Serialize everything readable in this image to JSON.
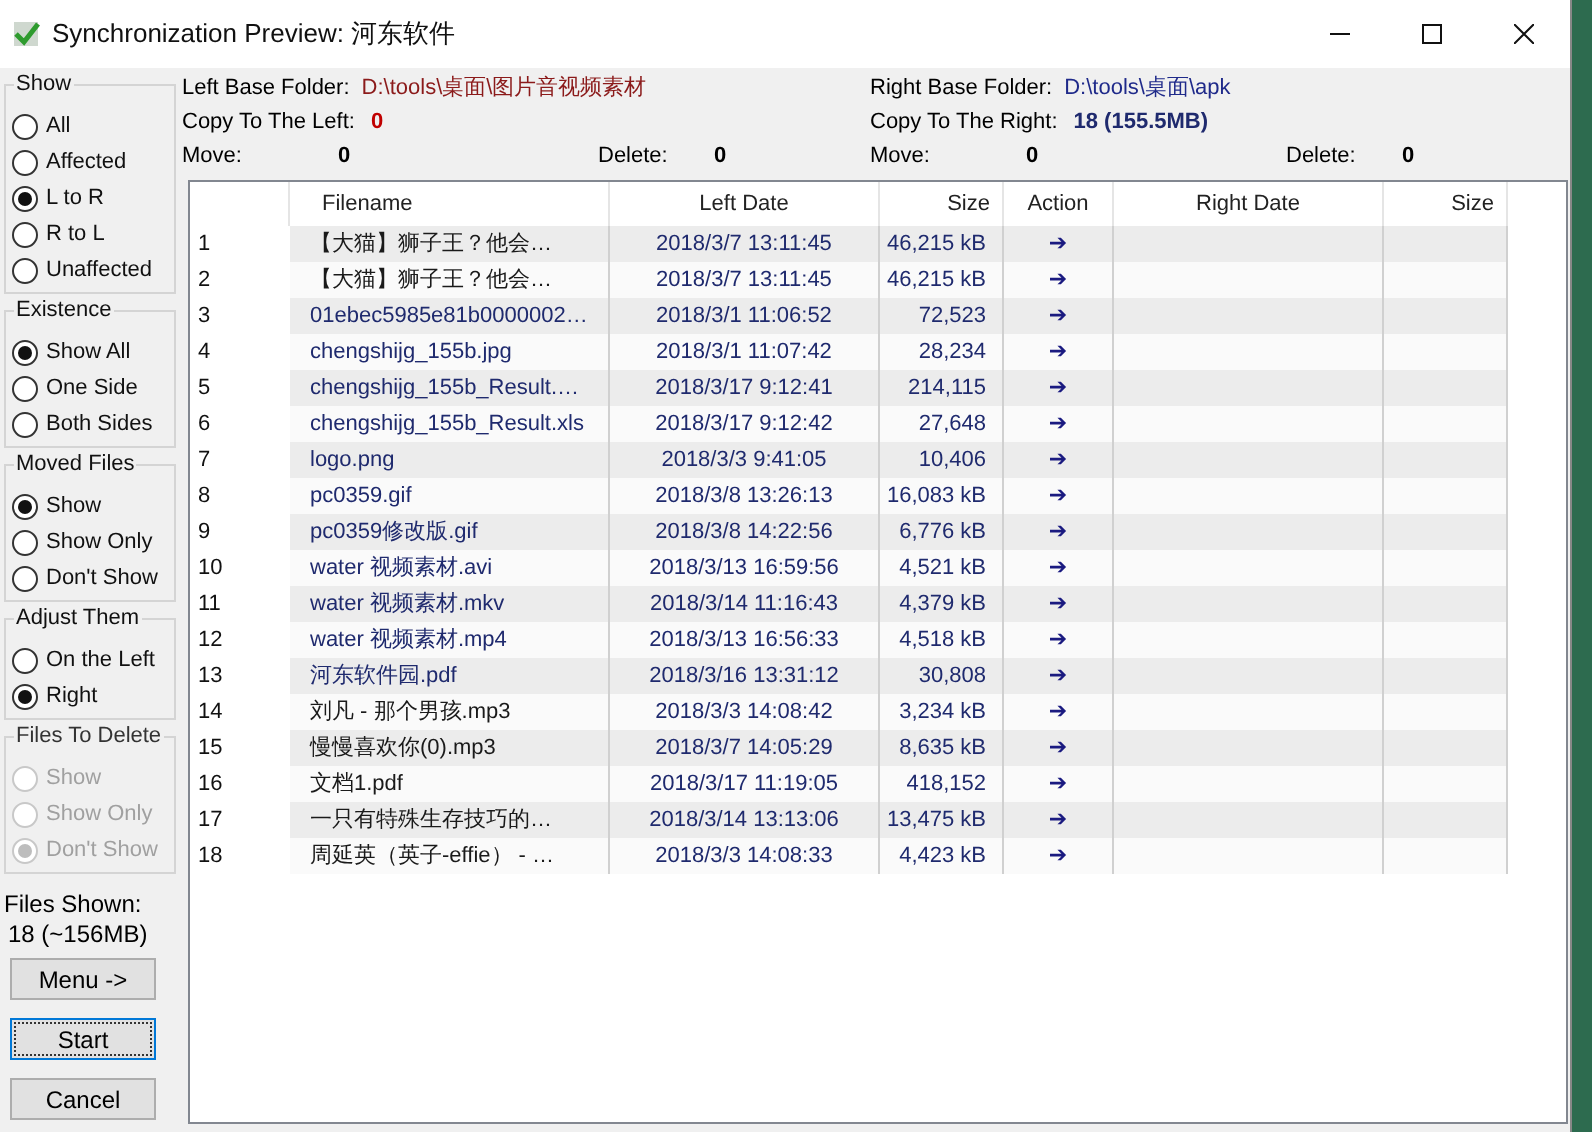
{
  "window": {
    "title": "Synchronization Preview: 河东软件"
  },
  "info": {
    "left": {
      "folder_label": "Left Base Folder:",
      "folder": "D:\\tools\\桌面\\图片音视频素材",
      "copy_label": "Copy To The Left:",
      "copy": "0",
      "move_label": "Move:",
      "move": "0",
      "delete_label": "Delete:",
      "delete": "0"
    },
    "right": {
      "folder_label": "Right Base Folder:",
      "folder": "D:\\tools\\桌面\\apk",
      "copy_label": "Copy To The Right:",
      "copy": "18 (155.5MB)",
      "move_label": "Move:",
      "move": "0",
      "delete_label": "Delete:",
      "delete": "0"
    }
  },
  "filters": [
    {
      "title": "Show",
      "disabled": false,
      "options": [
        {
          "label": "All",
          "selected": false
        },
        {
          "label": "Affected",
          "selected": false
        },
        {
          "label": "L to R",
          "selected": true
        },
        {
          "label": "R to L",
          "selected": false
        },
        {
          "label": "Unaffected",
          "selected": false
        }
      ]
    },
    {
      "title": "Existence",
      "disabled": false,
      "options": [
        {
          "label": "Show All",
          "selected": true
        },
        {
          "label": "One Side",
          "selected": false
        },
        {
          "label": "Both Sides",
          "selected": false
        }
      ]
    },
    {
      "title": "Moved Files",
      "disabled": false,
      "options": [
        {
          "label": "Show",
          "selected": true
        },
        {
          "label": "Show Only",
          "selected": false
        },
        {
          "label": "Don't Show",
          "selected": false
        }
      ]
    },
    {
      "title": "Adjust Them",
      "disabled": false,
      "options": [
        {
          "label": "On the Left",
          "selected": false
        },
        {
          "label": "Right",
          "selected": true
        }
      ]
    },
    {
      "title": "Files To Delete",
      "disabled": true,
      "options": [
        {
          "label": "Show",
          "selected": false
        },
        {
          "label": "Show Only",
          "selected": false
        },
        {
          "label": "Don't Show",
          "selected": true
        }
      ]
    }
  ],
  "files_shown": {
    "label": "Files Shown:",
    "value": "18 (~156MB)"
  },
  "buttons": [
    {
      "label": "Menu ->",
      "focused": false
    },
    {
      "label": "Start",
      "focused": true
    },
    {
      "label": "Cancel",
      "focused": false
    }
  ],
  "table": {
    "columns": [
      "Filename",
      "Left Date",
      "Size",
      "Action",
      "Right Date",
      "Size"
    ],
    "rows": [
      {
        "number": "1",
        "filename": "【大猫】狮子王？他会…",
        "color": "#1a1a1a",
        "left_date": "2018/3/7 13:11:45",
        "size": "46,215 kB",
        "action": "➔"
      },
      {
        "number": "2",
        "filename": "【大猫】狮子王？他会…",
        "color": "#1a1a1a",
        "left_date": "2018/3/7 13:11:45",
        "size": "46,215 kB",
        "action": "➔"
      },
      {
        "number": "3",
        "filename": "01ebec5985e81b0000002…",
        "color": "#1f2a6e",
        "left_date": "2018/3/1 11:06:52",
        "size": "72,523",
        "action": "➔"
      },
      {
        "number": "4",
        "filename": "chengshijg_155b.jpg",
        "color": "#1f2a6e",
        "left_date": "2018/3/1 11:07:42",
        "size": "28,234",
        "action": "➔"
      },
      {
        "number": "5",
        "filename": "chengshijg_155b_Result.…",
        "color": "#1f2a6e",
        "left_date": "2018/3/17 9:12:41",
        "size": "214,115",
        "action": "➔"
      },
      {
        "number": "6",
        "filename": "chengshijg_155b_Result.xls",
        "color": "#1f2a6e",
        "left_date": "2018/3/17 9:12:42",
        "size": "27,648",
        "action": "➔"
      },
      {
        "number": "7",
        "filename": "logo.png",
        "color": "#1f2a6e",
        "left_date": "2018/3/3 9:41:05",
        "size": "10,406",
        "action": "➔"
      },
      {
        "number": "8",
        "filename": "pc0359.gif",
        "color": "#1f2a6e",
        "left_date": "2018/3/8 13:26:13",
        "size": "16,083 kB",
        "action": "➔"
      },
      {
        "number": "9",
        "filename": "pc0359修改版.gif",
        "color": "#1f2a6e",
        "left_date": "2018/3/8 14:22:56",
        "size": "6,776 kB",
        "action": "➔"
      },
      {
        "number": "10",
        "filename": "water 视频素材.avi",
        "color": "#1f2a6e",
        "left_date": "2018/3/13 16:59:56",
        "size": "4,521 kB",
        "action": "➔"
      },
      {
        "number": "11",
        "filename": "water 视频素材.mkv",
        "color": "#1f2a6e",
        "left_date": "2018/3/14 11:16:43",
        "size": "4,379 kB",
        "action": "➔"
      },
      {
        "number": "12",
        "filename": "water 视频素材.mp4",
        "color": "#1f2a6e",
        "left_date": "2018/3/13 16:56:33",
        "size": "4,518 kB",
        "action": "➔"
      },
      {
        "number": "13",
        "filename": "河东软件园.pdf",
        "color": "#1f2a6e",
        "left_date": "2018/3/16 13:31:12",
        "size": "30,808",
        "action": "➔"
      },
      {
        "number": "14",
        "filename": "刘凡 - 那个男孩.mp3",
        "color": "#1a1a1a",
        "left_date": "2018/3/3 14:08:42",
        "size": "3,234 kB",
        "action": "➔"
      },
      {
        "number": "15",
        "filename": "慢慢喜欢你(0).mp3",
        "color": "#1a1a1a",
        "left_date": "2018/3/7 14:05:29",
        "size": "8,635 kB",
        "action": "➔"
      },
      {
        "number": "16",
        "filename": "文档1.pdf",
        "color": "#1a1a1a",
        "left_date": "2018/3/17 11:19:05",
        "size": "418,152",
        "action": "➔"
      },
      {
        "number": "17",
        "filename": "一只有特殊生存技巧的…",
        "color": "#1a1a1a",
        "left_date": "2018/3/14 13:13:06",
        "size": "13,475 kB",
        "action": "➔"
      },
      {
        "number": "18",
        "filename": "周延英（英子-effie） - …",
        "color": "#1a1a1a",
        "left_date": "2018/3/3 14:08:33",
        "size": "4,423 kB",
        "action": "➔"
      }
    ]
  }
}
